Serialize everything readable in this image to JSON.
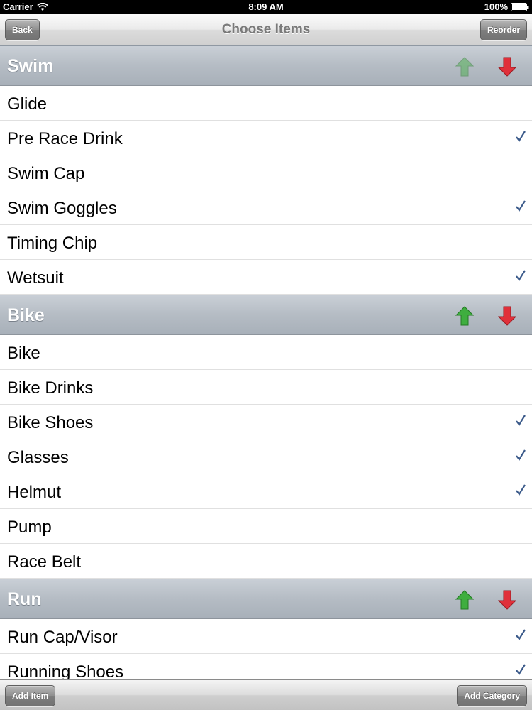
{
  "status_bar": {
    "carrier": "Carrier",
    "time": "8:09 AM",
    "battery": "100%"
  },
  "nav": {
    "title": "Choose Items",
    "back_label": "Back",
    "reorder_label": "Reorder"
  },
  "sections": [
    {
      "title": "Swim",
      "up_enabled": false,
      "down_enabled": true,
      "items": [
        {
          "label": "Glide",
          "checked": false
        },
        {
          "label": "Pre Race Drink",
          "checked": true
        },
        {
          "label": "Swim Cap",
          "checked": false
        },
        {
          "label": "Swim Goggles",
          "checked": true
        },
        {
          "label": "Timing Chip",
          "checked": false
        },
        {
          "label": "Wetsuit",
          "checked": true
        }
      ]
    },
    {
      "title": "Bike",
      "up_enabled": true,
      "down_enabled": true,
      "items": [
        {
          "label": "Bike",
          "checked": false
        },
        {
          "label": "Bike Drinks",
          "checked": false
        },
        {
          "label": "Bike Shoes",
          "checked": true
        },
        {
          "label": "Glasses",
          "checked": true
        },
        {
          "label": "Helmut",
          "checked": true
        },
        {
          "label": "Pump",
          "checked": false
        },
        {
          "label": "Race Belt",
          "checked": false
        }
      ]
    },
    {
      "title": "Run",
      "up_enabled": true,
      "down_enabled": true,
      "items": [
        {
          "label": "Run Cap/Visor",
          "checked": true
        },
        {
          "label": "Running Shoes",
          "checked": true
        }
      ]
    }
  ],
  "toolbar": {
    "add_item_label": "Add Item",
    "add_category_label": "Add Category"
  },
  "icons": {
    "up": "arrow-up-icon",
    "down": "arrow-down-icon",
    "check": "checkmark-icon"
  },
  "colors": {
    "up_arrow": "#3fae3f",
    "down_arrow": "#e0303a",
    "check": "#3b5a8a",
    "section_header": "#b5bcc4"
  }
}
